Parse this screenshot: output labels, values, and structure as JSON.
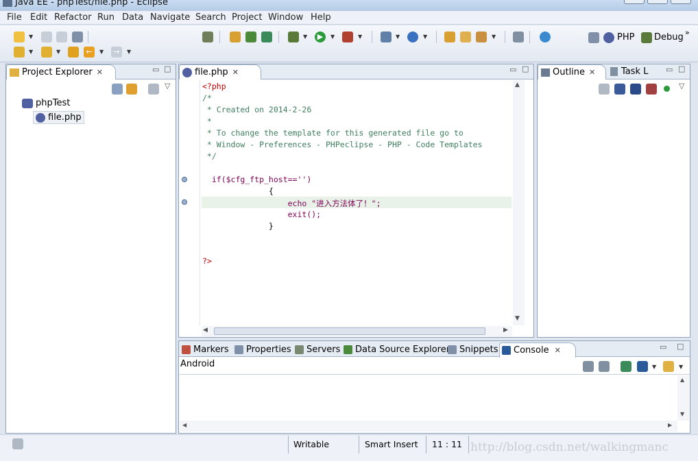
{
  "window": {
    "title": "Java EE - phpTest/file.php - Eclipse"
  },
  "menu": [
    "File",
    "Edit",
    "Refactor",
    "Run",
    "Data",
    "Navigate",
    "Search",
    "Project",
    "Window",
    "Help"
  ],
  "perspectives": {
    "php": "PHP",
    "debug": "Debug"
  },
  "project_explorer": {
    "tab_label": "Project Explorer",
    "tree": {
      "project": "phpTest",
      "file": "file.php"
    }
  },
  "editor": {
    "tab_label": "file.php",
    "lines": [
      "<?php",
      "/*",
      " * Created on 2014-2-26",
      " *",
      " * To change the template for this generated file go to",
      " * Window - Preferences - PHPeclipse - PHP - Code Templates",
      " */",
      "",
      "  if($cfg_ftp_host=='')",
      "              {",
      "                  echo \"进入方法体了！\";",
      "                  exit();",
      "              }",
      "",
      "",
      "?>"
    ]
  },
  "outline": {
    "tab_label": "Outline",
    "task_tab_label": "Task L"
  },
  "bottom_tabs": [
    "Markers",
    "Properties",
    "Servers",
    "Data Source Explorer",
    "Snippets",
    "Console"
  ],
  "console": {
    "label": "Android"
  },
  "statusbar": {
    "mode": "Writable",
    "insert": "Smart Insert",
    "position": "11 : 11"
  },
  "watermark": "http://blog.csdn.net/walkingmanc",
  "colors": {
    "keyword": "#7f0055",
    "comment": "#3f7f5f",
    "variable": "#7f9fbf",
    "string": "#2a00ff",
    "php_tag": "#c00000",
    "highlight": "#e8f2e8"
  }
}
